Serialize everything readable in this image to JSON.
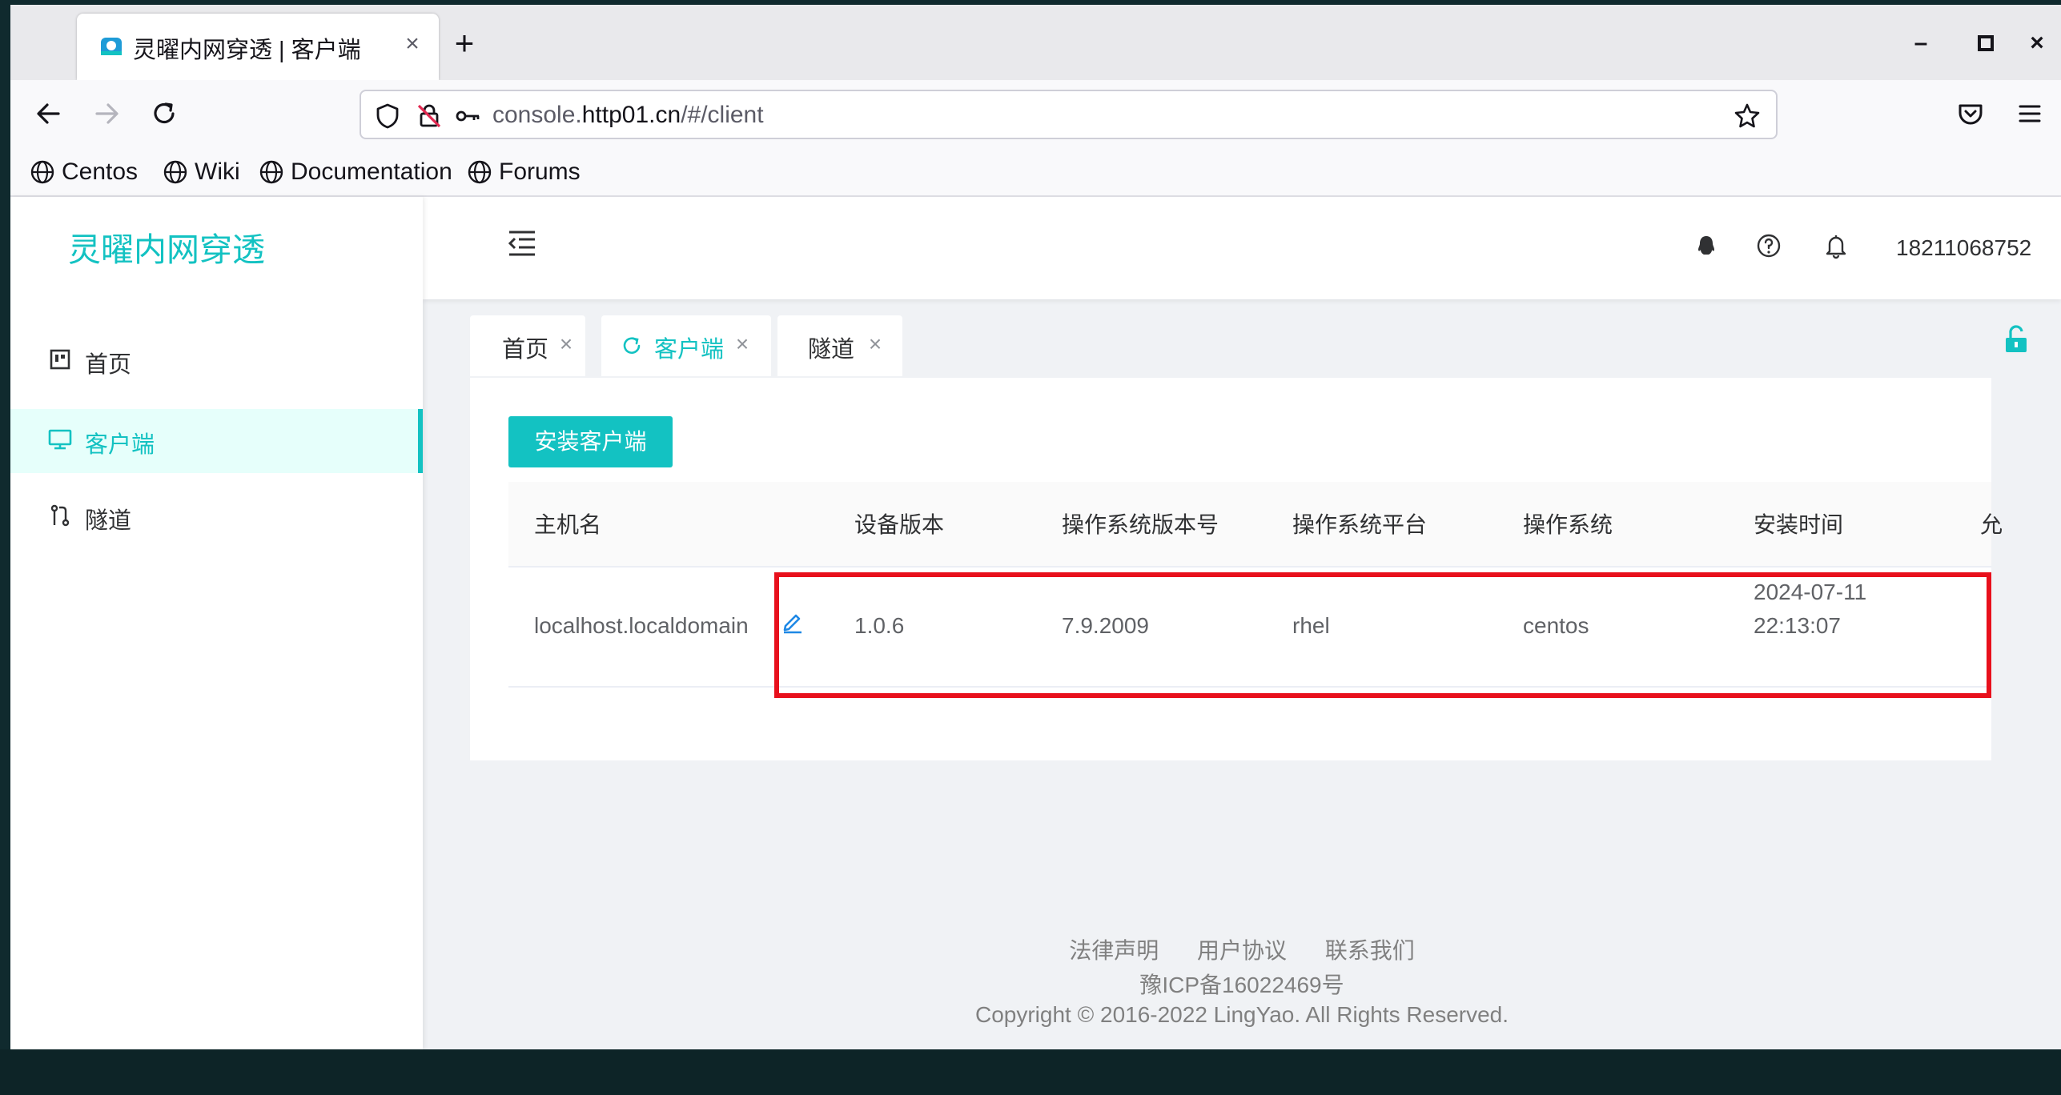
{
  "browser": {
    "tab_title": "灵曜内网穿透 | 客户端",
    "tab_close": "×",
    "new_tab": "+",
    "window_controls": {
      "minimize": "–",
      "maximize": "□",
      "close": "×"
    },
    "url": {
      "prefix": "console.",
      "domain": "http01.cn",
      "path": "/#/client"
    },
    "bookmarks": [
      "Centos",
      "Wiki",
      "Documentation",
      "Forums"
    ]
  },
  "app": {
    "brand": "灵曜内网穿透",
    "menu": [
      {
        "label": "首页",
        "icon": "dashboard-icon"
      },
      {
        "label": "客户端",
        "icon": "monitor-icon",
        "active": true
      },
      {
        "label": "隧道",
        "icon": "tunnel-icon"
      }
    ],
    "header": {
      "user": "18211068752"
    },
    "page_tabs": [
      {
        "label": "首页",
        "close": "×"
      },
      {
        "label": "客户端",
        "close": "×",
        "active": true
      },
      {
        "label": "隧道",
        "close": "×"
      }
    ],
    "install_button": "安装客户端",
    "table": {
      "columns": [
        "主机名",
        "设备版本",
        "操作系统版本号",
        "操作系统平台",
        "操作系统",
        "安装时间",
        "允"
      ],
      "rows": [
        {
          "hostname": "localhost.localdomain",
          "device_version": "1.0.6",
          "os_version": "7.9.2009",
          "os_platform": "rhel",
          "os": "centos",
          "install_date": "2024-07-11",
          "install_time": "22:13:07"
        }
      ]
    },
    "footer": {
      "links": [
        "法律声明",
        "用户协议",
        "联系我们"
      ],
      "icp": "豫ICP备16022469号",
      "copyright": "Copyright © 2016-2022 LingYao. All Rights Reserved."
    }
  },
  "colors": {
    "accent": "#13c2c2",
    "highlight": "#e8101c",
    "active_bg": "#e6fffb"
  }
}
